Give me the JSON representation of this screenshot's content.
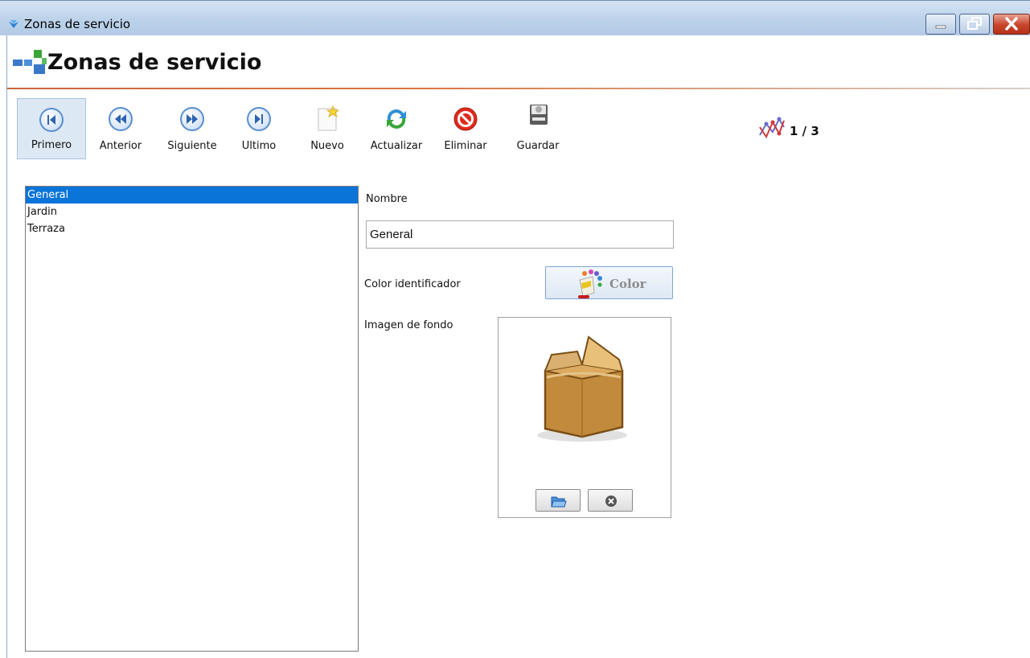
{
  "window": {
    "title": "Zonas de servicio"
  },
  "header": {
    "title": "Zonas de servicio"
  },
  "toolbar": {
    "first": "Primero",
    "previous": "Anterior",
    "next": "Siguiente",
    "last": "Ultimo",
    "new": "Nuevo",
    "refresh": "Actualizar",
    "delete": "Eliminar",
    "save": "Guardar"
  },
  "navigator": {
    "position": "1 / 3"
  },
  "zones": {
    "items": [
      "General",
      "Jardin",
      "Terraza"
    ],
    "selected": "General"
  },
  "form": {
    "name_label": "Nombre",
    "name_value": "General",
    "color_label": "Color identificador",
    "color_button": "Color",
    "image_label": "Imagen de fondo"
  },
  "icons": {
    "open_folder": "open-folder-icon",
    "clear": "clear-icon",
    "placeholder": "box-icon"
  },
  "colors": {
    "selection": "#0a74d9",
    "header_line": "#c8663a",
    "titlebar": "#bcd2ea"
  }
}
